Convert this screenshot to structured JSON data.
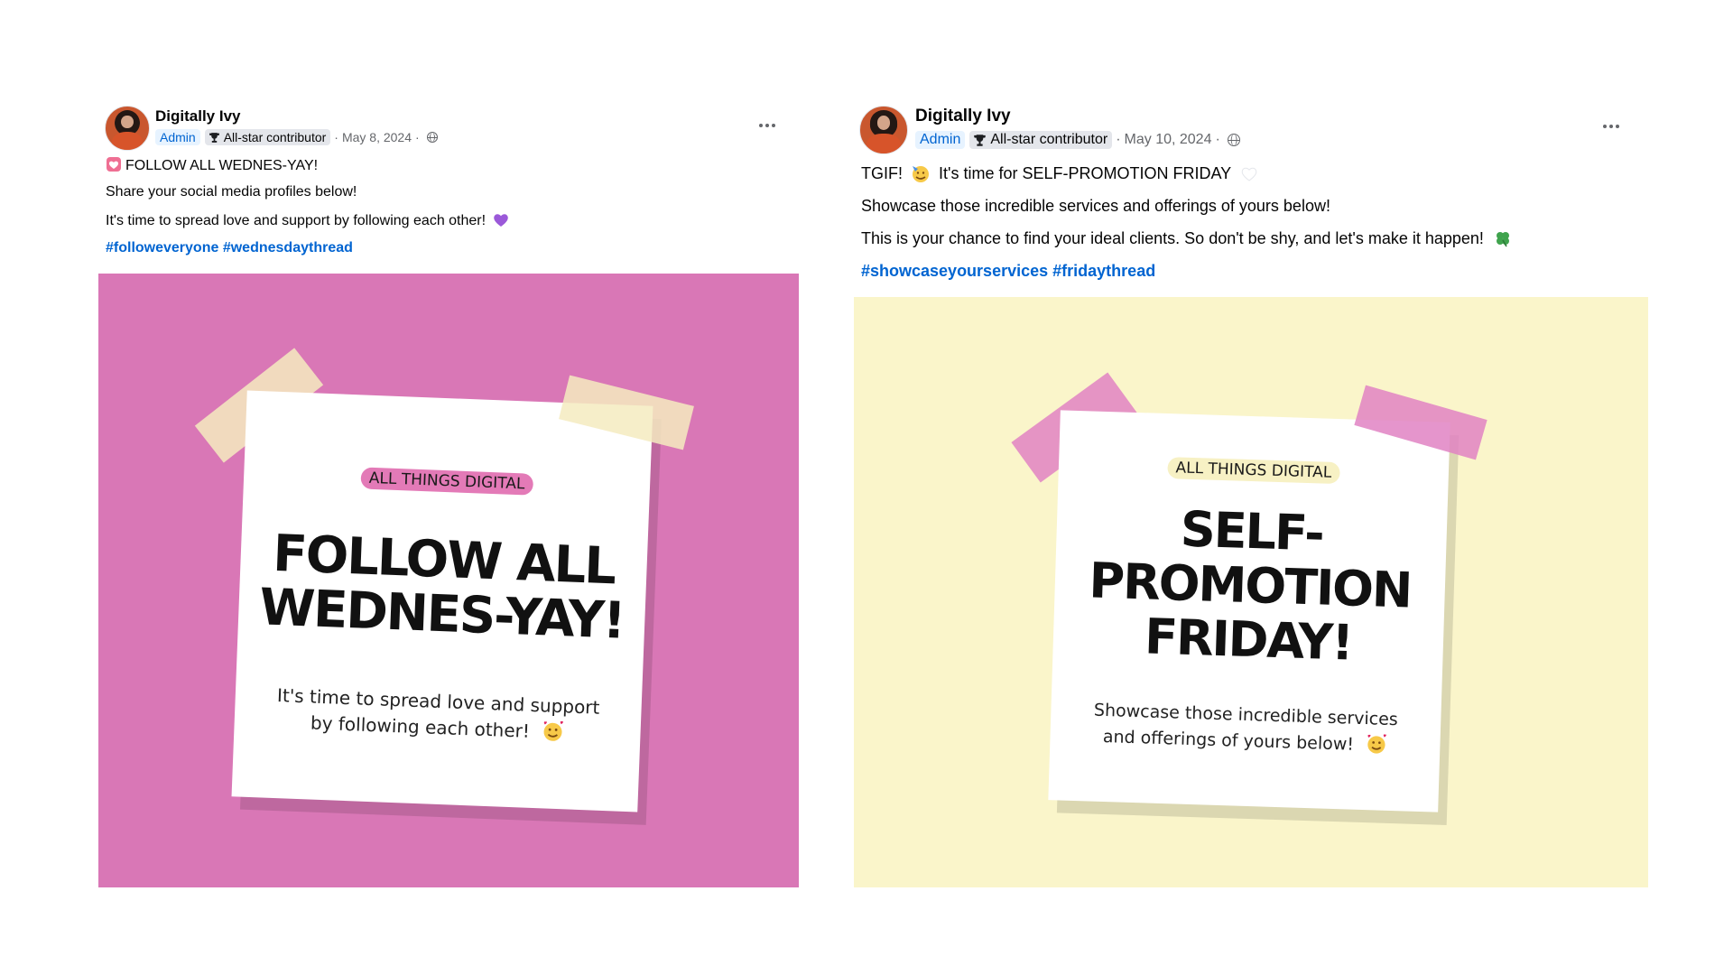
{
  "posts": [
    {
      "author": "Digitally Ivy",
      "admin_label": "Admin",
      "badge_label": "All-star contributor",
      "date": "May 8, 2024",
      "separator": "·",
      "lines": [
        "FOLLOW ALL WEDNES-YAY!",
        "Share your social media profiles below!",
        "It's time to spread love and support by following each other!"
      ],
      "hashtags": [
        "#followeveryone",
        "#wednesdaythread"
      ],
      "image": {
        "tag": "ALL THINGS DIGITAL",
        "title_lines": [
          "FOLLOW ALL",
          "WEDNES-YAY!"
        ],
        "body_lines": [
          "It's time to spread love and support",
          "by following each other!"
        ],
        "background": "#d977b6",
        "tape_color": "#f5ebc0",
        "tag_color": "#e37ab7"
      }
    },
    {
      "author": "Digitally Ivy",
      "admin_label": "Admin",
      "badge_label": "All-star contributor",
      "date": "May 10, 2024",
      "separator": "·",
      "lines": [
        "TGIF!",
        "It's time for SELF-PROMOTION FRIDAY",
        "Showcase those incredible services and offerings of yours below!",
        "This is your chance to find your ideal clients. So don't be shy, and let's make it happen!"
      ],
      "hashtags": [
        "#showcaseyourservices",
        "#fridaythread"
      ],
      "image": {
        "tag": "ALL THINGS DIGITAL",
        "title_lines": [
          "SELF-",
          "PROMOTION",
          "FRIDAY!"
        ],
        "body_lines": [
          "Showcase those incredible services",
          "and offerings of yours below!"
        ],
        "background": "#faf5ca",
        "tape_color": "#e183c3",
        "tag_color": "#f7f1c4"
      }
    }
  ],
  "icons": {
    "trophy": "trophy-icon",
    "globe": "globe-icon",
    "more": "more-options-icon",
    "heart_box": "heart-icon",
    "purple_heart": "purple-heart-icon",
    "party_face": "party-face-emoji",
    "white_heart": "white-heart-icon",
    "clover": "four-leaf-clover-icon",
    "hearts_face": "smiling-face-with-hearts-emoji"
  },
  "colors": {
    "link": "#0064d1",
    "meta": "#65676b",
    "text": "#050505"
  }
}
